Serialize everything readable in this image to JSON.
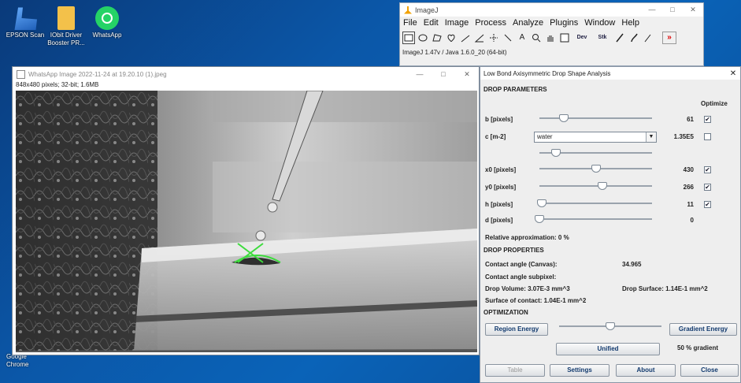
{
  "desktop": {
    "icons": [
      {
        "label": "EPSON Scan"
      },
      {
        "label": "IObit Driver Booster PR..."
      },
      {
        "label": "WhatsApp"
      },
      {
        "label": "Google Chrome"
      }
    ]
  },
  "imagej": {
    "title": "ImageJ",
    "controls": {
      "minimize": "—",
      "maximize": "□",
      "close": "✕"
    },
    "menu": [
      "File",
      "Edit",
      "Image",
      "Process",
      "Analyze",
      "Plugins",
      "Window",
      "Help"
    ],
    "tools": [
      "rectangle-tool",
      "oval-tool",
      "polygon-tool",
      "freehand-tool",
      "line-tool",
      "angle-tool",
      "point-tool",
      "wand-tool",
      "text-tool",
      "magnifier-tool",
      "scroll-tool",
      "color-picker-tool",
      "dev-tool",
      "stk-tool",
      "pencil-tool",
      "brush-tool",
      "flood-fill-tool",
      "more-tools"
    ],
    "tool_labels": {
      "text": "A",
      "dev": "Dev",
      "stk": "Stk",
      "more": "»"
    },
    "status": "ImageJ 1.47v / Java 1.6.0_20 (64-bit)"
  },
  "image_window": {
    "title": "WhatsApp Image 2022-11-24 at 19.20.10 (1).jpeg",
    "info": "848x480 pixels; 32-bit; 1.6MB",
    "controls": {
      "minimize": "—",
      "maximize": "□",
      "close": "✕"
    }
  },
  "dialog": {
    "title": "Low Bond Axisymmetric Drop Shape Analysis",
    "close": "✕",
    "drop_parameters": {
      "heading": "DROP PARAMETERS",
      "optimize_header": "Optimize",
      "b": {
        "label": "b [pixels]",
        "value": "61",
        "optimize": true,
        "slider": 0.22
      },
      "c": {
        "label": "c [m-2]",
        "value": "1.35E5",
        "optimize": false,
        "liquid": "water",
        "slider": 0.15
      },
      "x0": {
        "label": "x0 [pixels]",
        "value": "430",
        "optimize": true,
        "slider": 0.5
      },
      "y0": {
        "label": "y0 [pixels]",
        "value": "266",
        "optimize": true,
        "slider": 0.56
      },
      "h": {
        "label": "h [pixels]",
        "value": "11",
        "optimize": true,
        "slider": 0.02
      },
      "d": {
        "label": "d [pixels]",
        "value": "0",
        "optimize": null,
        "slider": 0.0
      },
      "relative_approximation": "Relative approximation: 0 %"
    },
    "drop_properties": {
      "heading": "DROP PROPERTIES",
      "contact_angle_canvas_label": "Contact angle (Canvas):",
      "contact_angle_canvas_value": "34.965",
      "contact_angle_subpixel_label": "Contact angle subpixel:",
      "drop_volume": "Drop Volume: 3.07E-3 mm^3",
      "drop_surface": "Drop Surface: 1.14E-1 mm^2",
      "surface_of_contact": "Surface of contact: 1.04E-1 mm^2"
    },
    "optimization": {
      "heading": "OPTIMIZATION",
      "region_energy": "Region Energy",
      "gradient_energy": "Gradient Energy",
      "unified": "Unified",
      "gradient_percent": "50 % gradient",
      "slider": 0.5
    },
    "buttons": {
      "table": "Table",
      "settings": "Settings",
      "about": "About",
      "close": "Close"
    }
  },
  "colors": {
    "accent": "#123a6e",
    "fit_curve": "#3ddc3d",
    "desktop_bg": "#0b57a8"
  }
}
